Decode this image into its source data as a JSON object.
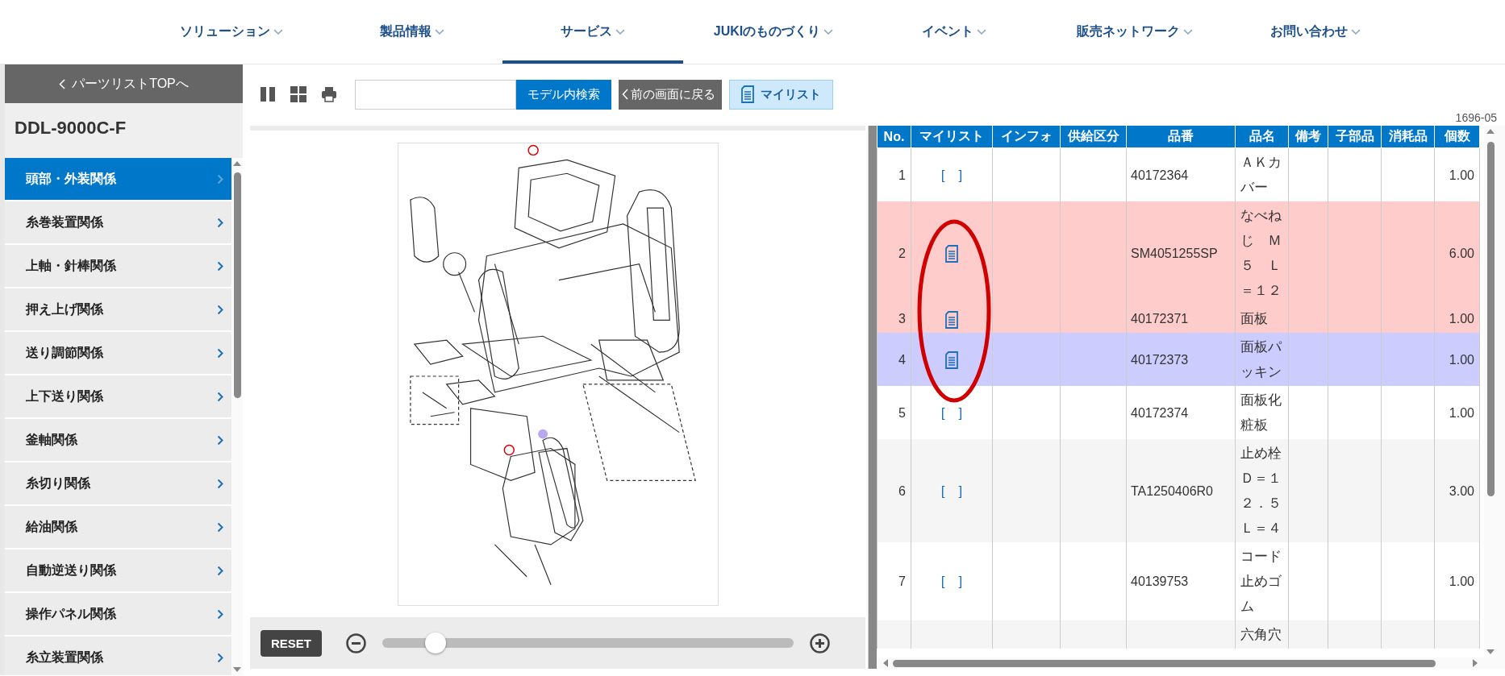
{
  "nav": {
    "items": [
      {
        "label": "ソリューション",
        "selected": false
      },
      {
        "label": "製品情報",
        "selected": false
      },
      {
        "label": "サービス",
        "selected": true
      },
      {
        "label": "JUKIのものづくり",
        "selected": false
      },
      {
        "label": "イベント",
        "selected": false
      },
      {
        "label": "販売ネットワーク",
        "selected": false
      },
      {
        "label": "お問い合わせ",
        "selected": false
      }
    ]
  },
  "sidebar": {
    "back_button": "パーツリストTOPへ",
    "model": "DDL-9000C-F",
    "items": [
      {
        "label": "頭部・外装関係",
        "selected": true
      },
      {
        "label": "糸巻装置関係",
        "selected": false
      },
      {
        "label": "上軸・針棒関係",
        "selected": false
      },
      {
        "label": "押え上げ関係",
        "selected": false
      },
      {
        "label": "送り調節関係",
        "selected": false
      },
      {
        "label": "上下送り関係",
        "selected": false
      },
      {
        "label": "釜軸関係",
        "selected": false
      },
      {
        "label": "糸切り関係",
        "selected": false
      },
      {
        "label": "給油関係",
        "selected": false
      },
      {
        "label": "自動逆送り関係",
        "selected": false
      },
      {
        "label": "操作パネル関係",
        "selected": false
      },
      {
        "label": "糸立装置関係",
        "selected": false
      }
    ]
  },
  "toolbar": {
    "search_button": "モデル内検索",
    "back_button": "前の画面に戻る",
    "mylist_button": "マイリスト"
  },
  "drawing_code": "1696-05",
  "viewer": {
    "reset_button": "RESET",
    "zoom": {
      "level": 0.13
    }
  },
  "table": {
    "columns": [
      "No.",
      "マイリスト",
      "インフォ",
      "供給区分",
      "品番",
      "品名",
      "備考",
      "子部品",
      "消耗品",
      "個数"
    ],
    "rows": [
      {
        "no": "1",
        "in_mylist": false,
        "mylist_label": "[　]",
        "part_no": "40172364",
        "name": "ＡＫカバー",
        "quantity": "1.00",
        "color": "#ffffff"
      },
      {
        "no": "2",
        "in_mylist": true,
        "part_no": "SM4051255SP",
        "name": "なべねじ　Ｍ５　Ｌ＝１２",
        "quantity": "6.00",
        "color": "#ffcccc"
      },
      {
        "no": "3",
        "in_mylist": true,
        "part_no": "40172371",
        "name": "面板",
        "quantity": "1.00",
        "color": "#ffcccc"
      },
      {
        "no": "4",
        "in_mylist": true,
        "part_no": "40172373",
        "name": "面板パッキン",
        "quantity": "1.00",
        "color": "#ccccff"
      },
      {
        "no": "5",
        "in_mylist": false,
        "mylist_label": "[　]",
        "part_no": "40172374",
        "name": "面板化粧板",
        "quantity": "1.00",
        "color": "#ffffff"
      },
      {
        "no": "6",
        "in_mylist": false,
        "mylist_label": "[　]",
        "part_no": "TA1250406R0",
        "name": "止め栓Ｄ＝１２．５Ｌ＝４",
        "quantity": "3.00",
        "color": "#f5f5f5"
      },
      {
        "no": "7",
        "in_mylist": false,
        "mylist_label": "[　]",
        "part_no": "40139753",
        "name": "コード止めゴム",
        "quantity": "1.00",
        "color": "#ffffff"
      },
      {
        "name": "六角穴",
        "color": "#f5f5f5"
      }
    ]
  }
}
